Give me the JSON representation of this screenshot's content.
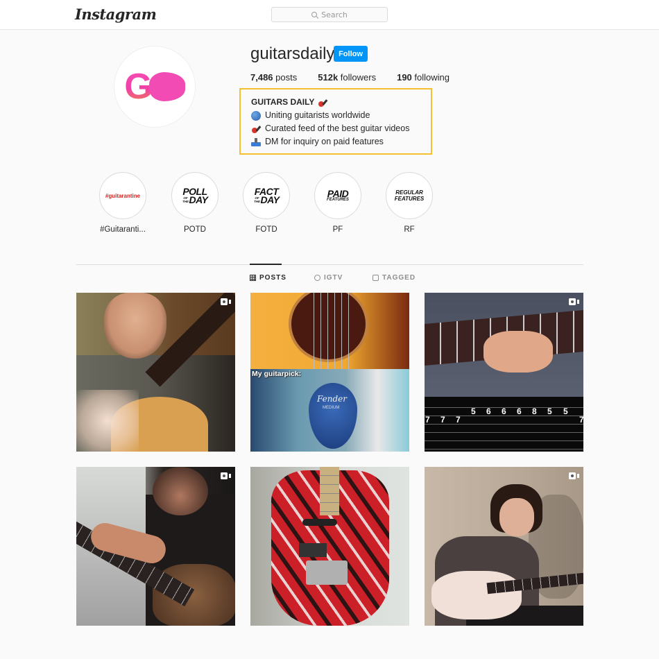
{
  "header": {
    "logo": "Instagram",
    "search_placeholder": "Search"
  },
  "profile": {
    "username": "guitarsdaily",
    "follow_label": "Follow",
    "avatar_text": "G",
    "stats": {
      "posts_value": "7,486",
      "posts_label": "posts",
      "followers_value": "512k",
      "followers_label": "followers",
      "following_value": "190",
      "following_label": "following"
    },
    "bio": {
      "title": "GUITARS DAILY",
      "title_icon": "guitar-icon",
      "lines": [
        {
          "icon": "globe-icon",
          "text": "Uniting guitarists worldwide"
        },
        {
          "icon": "guitar-icon",
          "text": "Curated feed of the best guitar videos"
        },
        {
          "icon": "inbox-tray-icon",
          "text": "DM for inquiry on paid features"
        }
      ],
      "highlight_color": "#f5c030"
    }
  },
  "highlights": [
    {
      "label": "#Guitaranti...",
      "cover": "#guitarantine"
    },
    {
      "label": "POTD",
      "cover_big1": "POLL",
      "cover_small": "OF THE",
      "cover_big2": "DAY"
    },
    {
      "label": "FOTD",
      "cover_big1": "FACT",
      "cover_small": "OF THE",
      "cover_big2": "DAY"
    },
    {
      "label": "PF",
      "cover_big1": "PAID",
      "cover_small": "FEATURES"
    },
    {
      "label": "RF",
      "cover_line1": "REGULAR",
      "cover_line2": "FEATURES"
    }
  ],
  "tabs": [
    {
      "label": "POSTS",
      "icon": "grid-icon",
      "active": true
    },
    {
      "label": "IGTV",
      "icon": "igtv-icon",
      "active": false
    },
    {
      "label": "TAGGED",
      "icon": "tagged-icon",
      "active": false
    }
  ],
  "posts": [
    {
      "type": "video",
      "description": "man with eyes closed playing classical guitar"
    },
    {
      "type": "image",
      "description": "acoustic guitar soundhole and cartoon meme",
      "caption": "My guitarpick:",
      "pick_brand": "Fender",
      "pick_gauge": "MEDIUM"
    },
    {
      "type": "video",
      "description": "hand on fretboard with tab overlay",
      "tab_numbers_upper": [
        "5",
        "6",
        "6",
        "6",
        "8",
        "5",
        "5"
      ],
      "tab_numbers_lower": [
        "7",
        "7",
        "7",
        "7"
      ]
    },
    {
      "type": "video",
      "description": "man with glasses playing multi-string guitar"
    },
    {
      "type": "image",
      "description": "red black and white striped electric guitar"
    },
    {
      "type": "video",
      "description": "young man playing white electric guitar"
    }
  ],
  "colors": {
    "accent": "#0095f6",
    "background": "#fafafa",
    "text": "#262626",
    "muted": "#8e8e8e",
    "border": "#dbdbdb"
  }
}
